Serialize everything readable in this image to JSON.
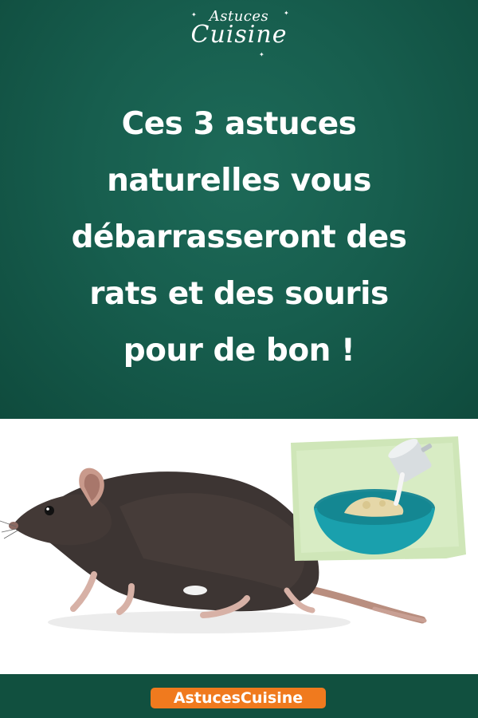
{
  "logo": {
    "line1": "Astuces",
    "line2": "Cuisine"
  },
  "headline": {
    "line1": "Ces 3 astuces",
    "line2": "naturelles vous",
    "line3": "débarrasseront des",
    "line4": "rats et des souris",
    "line5": "pour de bon !"
  },
  "footer": {
    "brand": "AstucesCuisine"
  },
  "colors": {
    "background_green": "#175e4e",
    "footer_green": "#11503f",
    "badge_orange": "#f07a1e",
    "text_white": "#ffffff"
  },
  "images": {
    "rat": "rat-illustration",
    "bowl": "bowl-with-powder-illustration"
  }
}
